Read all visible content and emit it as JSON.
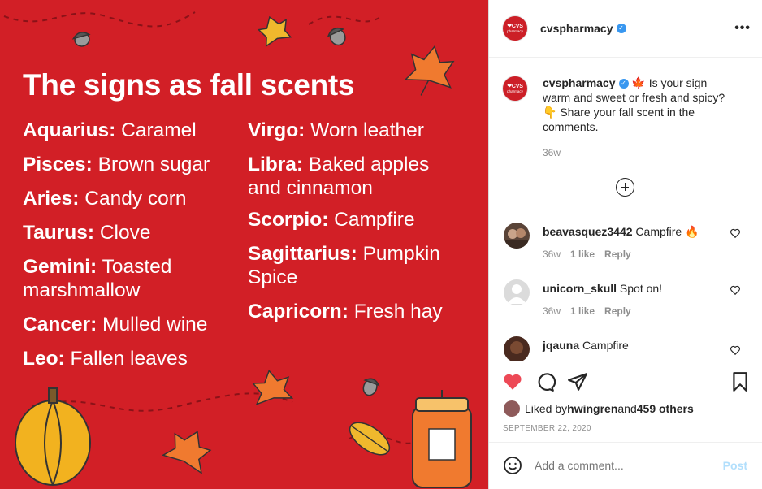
{
  "image": {
    "title": "The signs as fall scents",
    "left_signs": [
      {
        "sign": "Aquarius:",
        "scent": " Caramel"
      },
      {
        "sign": "Pisces:",
        "scent": " Brown sugar"
      },
      {
        "sign": "Aries:",
        "scent": " Candy corn"
      },
      {
        "sign": "Taurus:",
        "scent": " Clove"
      },
      {
        "sign": "Gemini:",
        "scent": " Toasted marshmallow"
      },
      {
        "sign": "Cancer:",
        "scent": " Mulled wine"
      },
      {
        "sign": "Leo:",
        "scent": " Fallen leaves"
      }
    ],
    "right_signs": [
      {
        "sign": "Virgo:",
        "scent": " Worn leather"
      },
      {
        "sign": "Libra:",
        "scent": " Baked apples and cinnamon"
      },
      {
        "sign": "Scorpio:",
        "scent": " Campfire"
      },
      {
        "sign": "Sagittarius:",
        "scent": " Pumpkin Spice"
      },
      {
        "sign": "Capricorn:",
        "scent": " Fresh hay"
      }
    ],
    "bg_color": "#d21f26"
  },
  "header": {
    "username": "cvspharmacy",
    "logo_line1": "❤CVS",
    "logo_line2": "pharmacy",
    "more_icon": "•••"
  },
  "caption": {
    "username": "cvspharmacy",
    "text": " 🍁 Is your sign warm and sweet or fresh and spicy? 👇 Share your fall scent in the comments.",
    "time": "36w"
  },
  "comments": [
    {
      "user": "beavasquez3442",
      "text": " Campfire 🔥",
      "time": "36w",
      "likes": "1 like",
      "reply": "Reply",
      "avatar_color": "#5a4438"
    },
    {
      "user": "unicorn_skull",
      "text": " Spot on!",
      "time": "36w",
      "likes": "1 like",
      "reply": "Reply",
      "avatar_color": "#dbdbdb"
    },
    {
      "user": "jqauna",
      "text": " Campfire",
      "time": "",
      "likes": "",
      "reply": "",
      "avatar_color": "#4a2a1f"
    }
  ],
  "actions": {
    "liked_by_prefix": "Liked by ",
    "liked_by_user": "hwingren",
    "and": " and ",
    "others": "459 others",
    "date": "SEPTEMBER 22, 2020",
    "heart_color": "#ed4956"
  },
  "add_comment": {
    "placeholder": "Add a comment...",
    "post_label": "Post"
  }
}
